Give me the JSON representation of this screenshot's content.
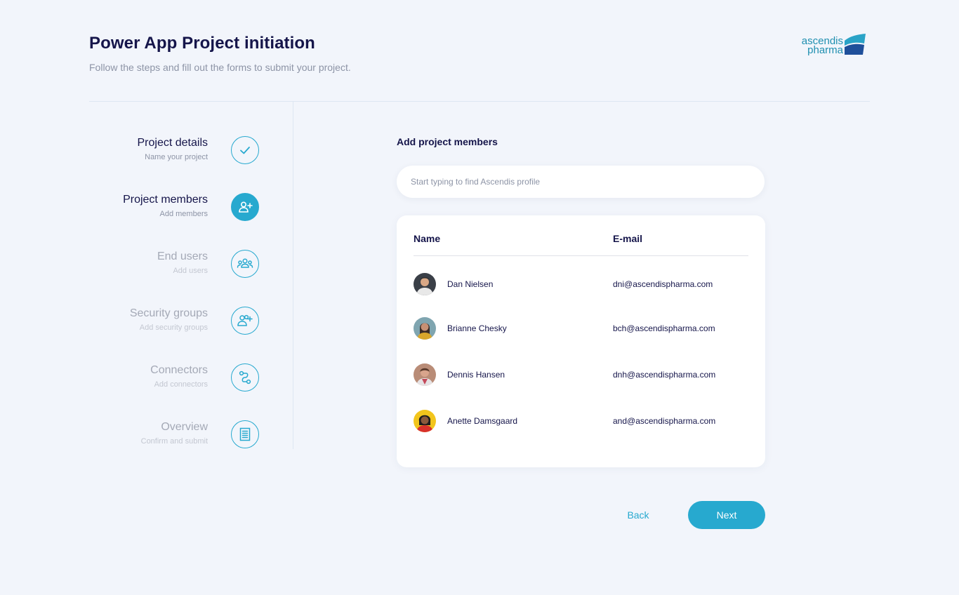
{
  "header": {
    "title": "Power App Project initiation",
    "subtitle": "Follow the steps and fill out the forms to submit your project.",
    "logo": {
      "line1": "ascendis",
      "line2": "pharma"
    }
  },
  "steps": [
    {
      "title": "Project details",
      "subtitle": "Name your project",
      "icon": "check-icon",
      "status": "completed"
    },
    {
      "title": "Project members",
      "subtitle": "Add members",
      "icon": "add-user-icon",
      "status": "active"
    },
    {
      "title": "End users",
      "subtitle": "Add users",
      "icon": "users-group-icon",
      "status": "pending"
    },
    {
      "title": "Security groups",
      "subtitle": "Add security groups",
      "icon": "add-users-icon",
      "status": "pending"
    },
    {
      "title": "Connectors",
      "subtitle": "Add connectors",
      "icon": "connector-icon",
      "status": "pending"
    },
    {
      "title": "Overview",
      "subtitle": "Confirm and submit",
      "icon": "document-icon",
      "status": "pending"
    }
  ],
  "main": {
    "section_title": "Add project members",
    "search_placeholder": "Start typing to find Ascendis profile",
    "table": {
      "columns": [
        "Name",
        "E-mail"
      ],
      "rows": [
        {
          "name": "Dan Nielsen",
          "email": "dni@ascendispharma.com"
        },
        {
          "name": "Brianne Chesky",
          "email": "bch@ascendispharma.com"
        },
        {
          "name": "Dennis Hansen",
          "email": "dnh@ascendispharma.com"
        },
        {
          "name": "Anette Damsgaard",
          "email": "and@ascendispharma.com"
        }
      ]
    }
  },
  "actions": {
    "back": "Back",
    "next": "Next"
  },
  "colors": {
    "accent": "#27a9cf",
    "title": "#15154a",
    "background": "#f2f5fb"
  }
}
